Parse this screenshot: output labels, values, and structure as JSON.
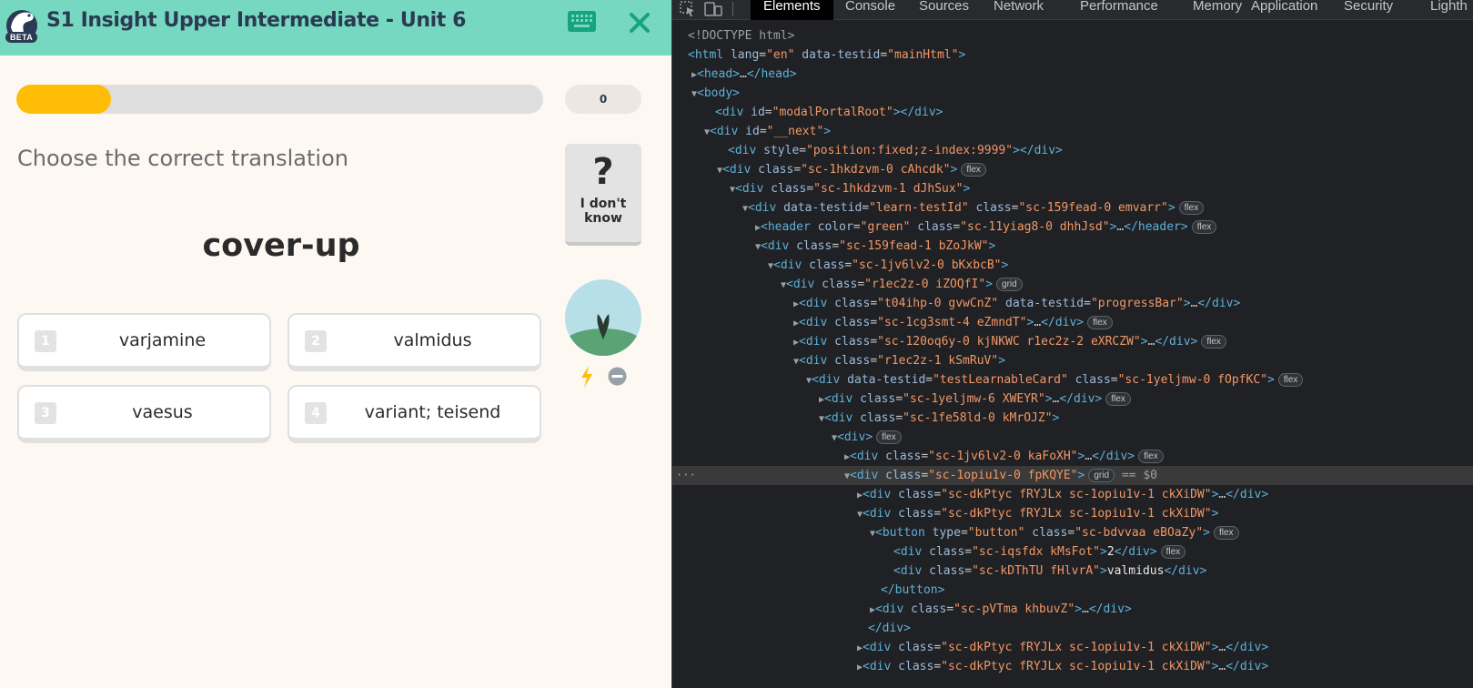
{
  "app": {
    "beta_badge": "BETA",
    "course_title": "S1 Insight Upper Intermediate - Unit 6",
    "progress_fraction": 0.18,
    "score": "0",
    "prompt": "Choose the correct translation",
    "word": "cover-up",
    "dont_know_icon": "?",
    "dont_know_label": "I don't know",
    "icons": {
      "keyboard": "keyboard-icon",
      "close": "close-icon",
      "avatar": "plant-sprout-avatar",
      "bolt": "lightning-bolt-icon",
      "minus": "minus-circle-icon"
    },
    "choices": [
      {
        "num": "1",
        "label": "varjamine"
      },
      {
        "num": "2",
        "label": "valmidus"
      },
      {
        "num": "3",
        "label": "vaesus"
      },
      {
        "num": "4",
        "label": "variant; teisend"
      }
    ],
    "colors": {
      "header": "#76d8c0",
      "accent_dark": "#2b3a52",
      "progress": "#ffbd06",
      "icon_green": "#17a37d"
    }
  },
  "devtools": {
    "tabs": [
      "Elements",
      "Console",
      "Sources",
      "Network",
      "Performance",
      "Memory",
      "Application",
      "Security",
      "Lighth"
    ],
    "active_tab": "Elements",
    "selected_suffix": "== $0"
  }
}
